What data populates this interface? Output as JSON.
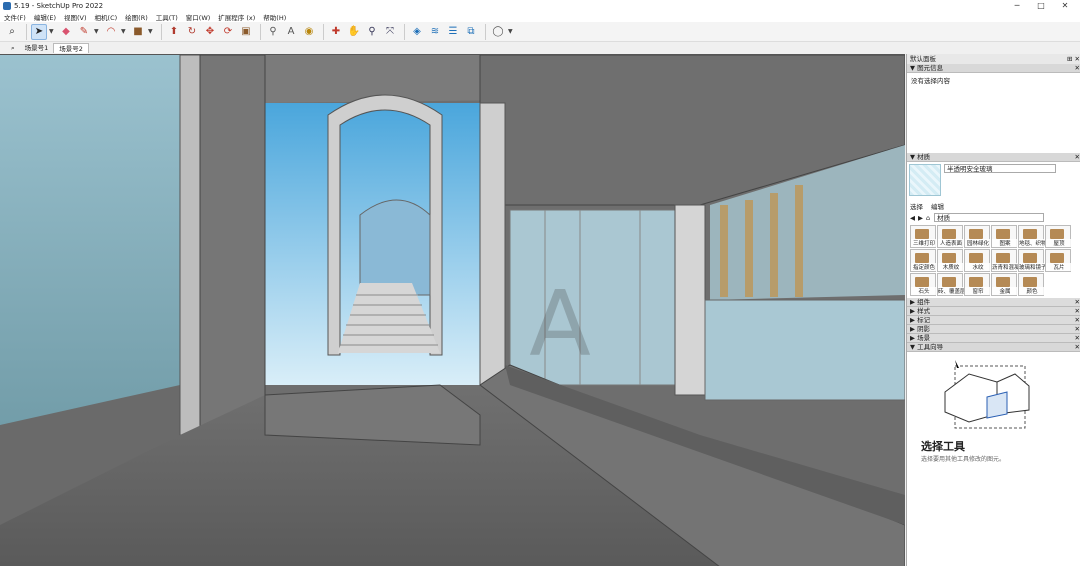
{
  "window": {
    "title": "5.19 - SketchUp Pro 2022",
    "minimize": "─",
    "maximize": "□",
    "close": "✕"
  },
  "menu": [
    "文件(F)",
    "编辑(E)",
    "视图(V)",
    "相机(C)",
    "绘图(R)",
    "工具(T)",
    "窗口(W)",
    "扩展程序 (x)",
    "帮助(H)"
  ],
  "toolbar_icons": [
    "search-icon",
    "select-icon",
    "eraser-icon",
    "pencil-icon",
    "arc-icon",
    "rectangle-icon",
    "pushpull-icon",
    "followme-icon",
    "move-icon",
    "rotate-icon",
    "scale-icon",
    "tape-icon",
    "text-icon",
    "paint-icon",
    "orbit-icon",
    "pan-icon",
    "zoom-icon",
    "zoom-extents-icon",
    "section-icon",
    "section-fill-icon",
    "section-display-icon",
    "section-cut-icon",
    "account-icon"
  ],
  "tabs": [
    "场景号1",
    "场景号2"
  ],
  "tab_search_icon": "⌕",
  "tray": {
    "title": "默认面板",
    "entity_info": {
      "header": "图元信息",
      "body": "没有选择内容"
    },
    "materials": {
      "header": "材质",
      "current": "半透明安全玻璃",
      "tab_select": "选择",
      "tab_edit": "编辑",
      "library": "材质",
      "items": [
        "三维打印",
        "人造表面",
        "园林绿化",
        "图案",
        "地毯、织物",
        "屋顶",
        "指定颜色",
        "木质纹",
        "水纹",
        "沥青和混凝土",
        "玻璃和镜子",
        "瓦片",
        "石头",
        "砖、覆盖层",
        "窗帘",
        "金属",
        "颜色"
      ]
    },
    "collapsed_panels": [
      "组件",
      "样式",
      "标记",
      "阴影",
      "场景"
    ],
    "instructor": {
      "header": "工具向导",
      "title": "选择工具",
      "subtitle": "选择要用其他工具修改的图元。"
    }
  }
}
